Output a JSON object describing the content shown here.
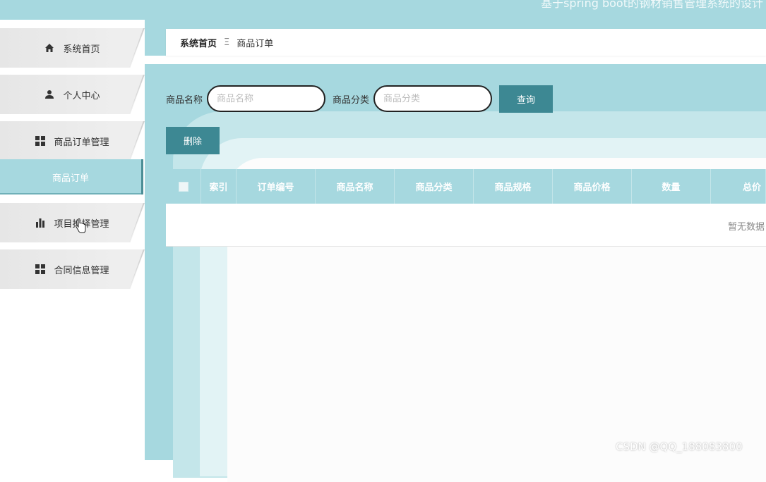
{
  "header": {
    "title": "基于spring boot的钢材销售管理系统的设计"
  },
  "sidebar": {
    "items": [
      {
        "label": "系统首页",
        "icon": "home-icon"
      },
      {
        "label": "个人中心",
        "icon": "user-icon"
      },
      {
        "label": "商品订单管理",
        "icon": "grid-icon"
      },
      {
        "label": "项目推择管理",
        "icon": "bar-chart-icon"
      },
      {
        "label": "合同信息管理",
        "icon": "grid-icon"
      }
    ],
    "submenu": {
      "label": "商品订单"
    }
  },
  "breadcrumb": {
    "home": "系统首页",
    "separator": "Ξ",
    "current": "商品订单"
  },
  "search": {
    "name_label": "商品名称",
    "name_placeholder": "商品名称",
    "category_label": "商品分类",
    "category_placeholder": "商品分类",
    "search_button": "查询"
  },
  "actions": {
    "delete_button": "删除"
  },
  "table": {
    "columns": [
      "索引",
      "订单编号",
      "商品名称",
      "商品分类",
      "商品规格",
      "商品价格",
      "数量",
      "总价"
    ],
    "rows": [],
    "empty_text": "暂无数据"
  },
  "watermark": "CSDN @QQ_188083800",
  "colors": {
    "accent": "#a6d8df",
    "button": "#3d8893",
    "active_border": "#4a8d95"
  }
}
